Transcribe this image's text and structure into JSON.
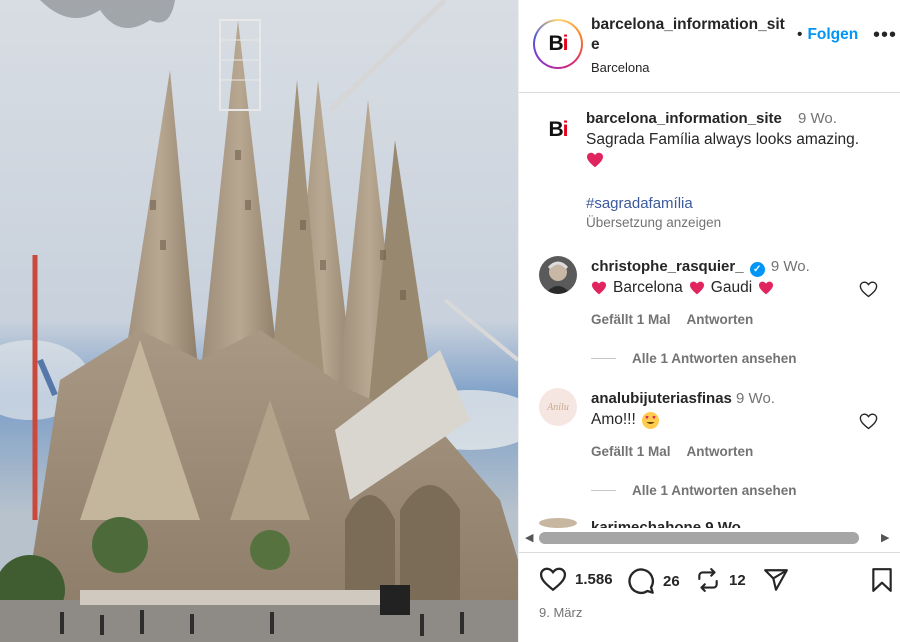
{
  "post": {
    "header": {
      "username": "barcelona_information_site",
      "location": "Barcelona",
      "follow_label": "Folgen",
      "follow_separator": "•",
      "more_label": "•••",
      "avatar_text": "Bi"
    },
    "caption": {
      "username": "barcelona_information_site",
      "time": "9 Wo.",
      "text": "Sagrada Família always looks amazing.",
      "hashtag": "#sagradafamília",
      "translate_label": "Übersetzung anzeigen"
    },
    "comments": [
      {
        "username": "christophe_rasquier_",
        "verified": true,
        "time": "9 Wo.",
        "text_parts": [
          "Barcelona",
          "Gaudi"
        ],
        "likes_label": "Gefällt 1 Mal",
        "reply_label": "Antworten",
        "replies_label": "Alle 1 Antworten ansehen"
      },
      {
        "username": "analubijuteriasfinas",
        "verified": false,
        "time": "9 Wo.",
        "text": "Amo!!!",
        "avatar_text": "Anilu",
        "likes_label": "Gefällt 1 Mal",
        "reply_label": "Antworten",
        "replies_label": "Alle 1 Antworten ansehen"
      }
    ],
    "next_comment_peek": "karimechahone 9 Wo.",
    "actions": {
      "likes": "1.586",
      "comments": "26",
      "reposts": "12"
    },
    "date": "9. März"
  },
  "colors": {
    "accent": "#0095f6",
    "heart": "#e0245e",
    "text": "#262626",
    "secondary": "#737373"
  },
  "icons": [
    "heart-icon",
    "comment-icon",
    "repost-icon",
    "share-icon",
    "bookmark-icon",
    "verified-icon",
    "more-icon"
  ]
}
